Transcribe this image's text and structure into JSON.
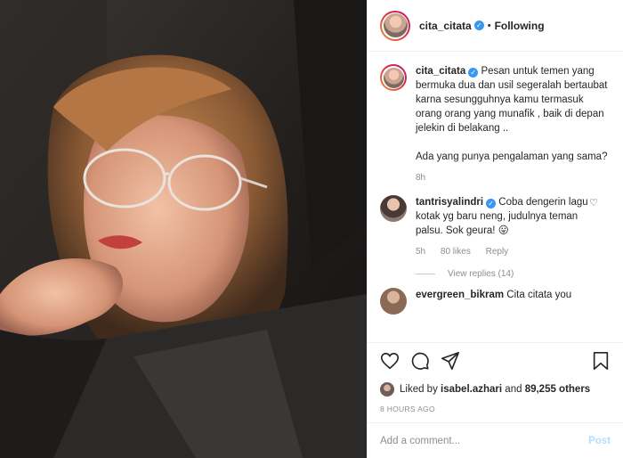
{
  "post": {
    "author": "cita_citata",
    "follow_status": "Following",
    "separator": "•",
    "caption": "Pesan untuk temen yang bermuka dua dan usil segeralah bertaubat karna sesungguhnya kamu termasuk orang orang yang munafik , baik di depan jelekin di belakang ..",
    "caption_2": "Ada yang punya pengalaman yang sama?",
    "caption_age": "8h"
  },
  "comments": [
    {
      "user": "tantrisyalindri",
      "text": "Coba dengerin lagu kotak yg baru neng, judulnya teman palsu. Sok geura! 😛",
      "age": "5h",
      "likes": "80 likes",
      "reply": "Reply",
      "view_replies": "View replies (14)"
    },
    {
      "user": "evergreen_bikram",
      "text": "Cita citata you"
    }
  ],
  "likes": {
    "prefix": "Liked by",
    "user": "isabel.azhari",
    "joiner": "and",
    "others": "89,255 others"
  },
  "timestamp": "8 HOURS AGO",
  "add_comment": {
    "placeholder": "Add a comment...",
    "post_label": "Post"
  },
  "icons": {
    "like": "heart-icon",
    "comment": "comment-icon",
    "share": "share-icon",
    "save": "bookmark-icon"
  },
  "colors": {
    "verified": "#3897f0",
    "post_disabled": "#b2dffc",
    "muted": "#8e8e8e"
  }
}
